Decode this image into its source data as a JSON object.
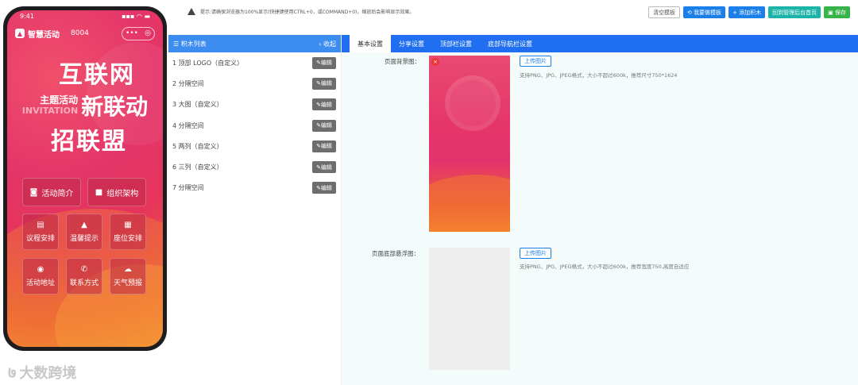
{
  "phone": {
    "time": "9:41",
    "signal": "▪▪▪ ◠ ▬",
    "brand": "智慧活动",
    "brand_num": "8004",
    "capsule_dots": "•••",
    "capsule_circle": "◎",
    "hero_line1": "互联网",
    "hero_small": "主题活动",
    "hero_invitation": "INVITATION",
    "hero_line2": "新联动",
    "hero_line3": "招联盟",
    "buttons_wide": [
      {
        "icon": "◙",
        "label": "活动简介"
      },
      {
        "icon": "■",
        "label": "组织架构"
      }
    ],
    "buttons_grid": [
      {
        "icon": "▤",
        "label": "议程安排"
      },
      {
        "icon": "▲",
        "label": "温馨提示"
      },
      {
        "icon": "▦",
        "label": "座位安排"
      },
      {
        "icon": "◉",
        "label": "活动地址"
      },
      {
        "icon": "✆",
        "label": "联系方式"
      },
      {
        "icon": "☁",
        "label": "天气预报"
      }
    ]
  },
  "watermark": "大数跨境",
  "hint": "提示:请确保浏览器为100%显示(快捷键使用CTRL+0，或COMMAND+0)，缩放后会影响显示效果。",
  "toolbar": {
    "clear": "清空模板",
    "my_template": "我要做模板",
    "add_block": "添加积木",
    "back_home": "回到管理后台首页",
    "save": "保存"
  },
  "panel": {
    "title": "积木列表",
    "collapse": "‹ 收起",
    "edit_label": "编辑",
    "items": [
      "1 顶部 LOGO（自定义）",
      "2 分隔空间",
      "3 大图（自定义）",
      "4 分隔空间",
      "5 两列（自定义）",
      "6 三列（自定义）",
      "7 分隔空间"
    ]
  },
  "tabs": [
    "基本设置",
    "分享设置",
    "顶部栏设置",
    "底部导航栏设置"
  ],
  "settings": {
    "bg_label": "页面背景图：",
    "upload": "上传图片",
    "bg_note": "支持PNG、JPG、JPEG格式，大小不超过600k，推荐尺寸750*1624",
    "float_label": "页面底部悬浮图：",
    "float_note": "支持PNG、JPG、JPEG格式，大小不超过600k，推荐宽度750,高度自适应",
    "delete_icon": "×"
  }
}
